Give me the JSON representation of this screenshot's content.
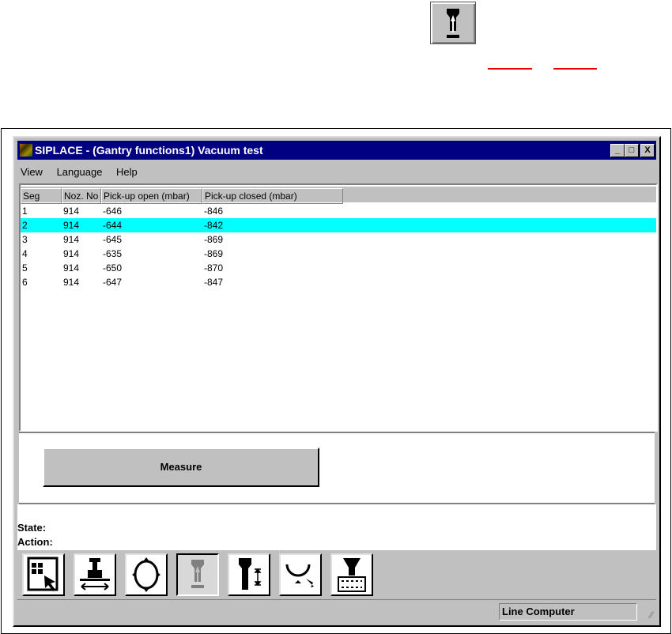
{
  "window": {
    "title": "SIPLACE - (Gantry functions1) Vacuum test",
    "minimize": "_",
    "maximize": "□",
    "close": "X"
  },
  "menu": [
    {
      "label": "View"
    },
    {
      "label": "Language"
    },
    {
      "label": "Help"
    }
  ],
  "table": {
    "columns": [
      "Seg",
      "Noz. No",
      "Pick-up open (mbar)",
      "Pick-up closed (mbar)"
    ],
    "rows": [
      [
        "1",
        "914",
        "-646",
        "-846"
      ],
      [
        "2",
        "914",
        "-644",
        "-842"
      ],
      [
        "3",
        "914",
        "-645",
        "-869"
      ],
      [
        "4",
        "914",
        "-635",
        "-869"
      ],
      [
        "5",
        "914",
        "-650",
        "-870"
      ],
      [
        "6",
        "914",
        "-647",
        "-847"
      ]
    ],
    "selected_row": 2,
    "highlight_color": "#00ffff"
  },
  "measure_label": "Measure",
  "status": {
    "state_label": "State:",
    "action_label": "Action:"
  },
  "toolbar": [
    {
      "icon": "component-select-icon"
    },
    {
      "icon": "gantry-move-icon"
    },
    {
      "icon": "revolver-head-icon"
    },
    {
      "icon": "vacuum-test-icon",
      "active": true
    },
    {
      "icon": "nozzle-height-icon"
    },
    {
      "icon": "pickup-rotation-icon"
    },
    {
      "icon": "nozzle-changer-icon"
    }
  ],
  "statusbar": {
    "mode": "Line Computer"
  }
}
